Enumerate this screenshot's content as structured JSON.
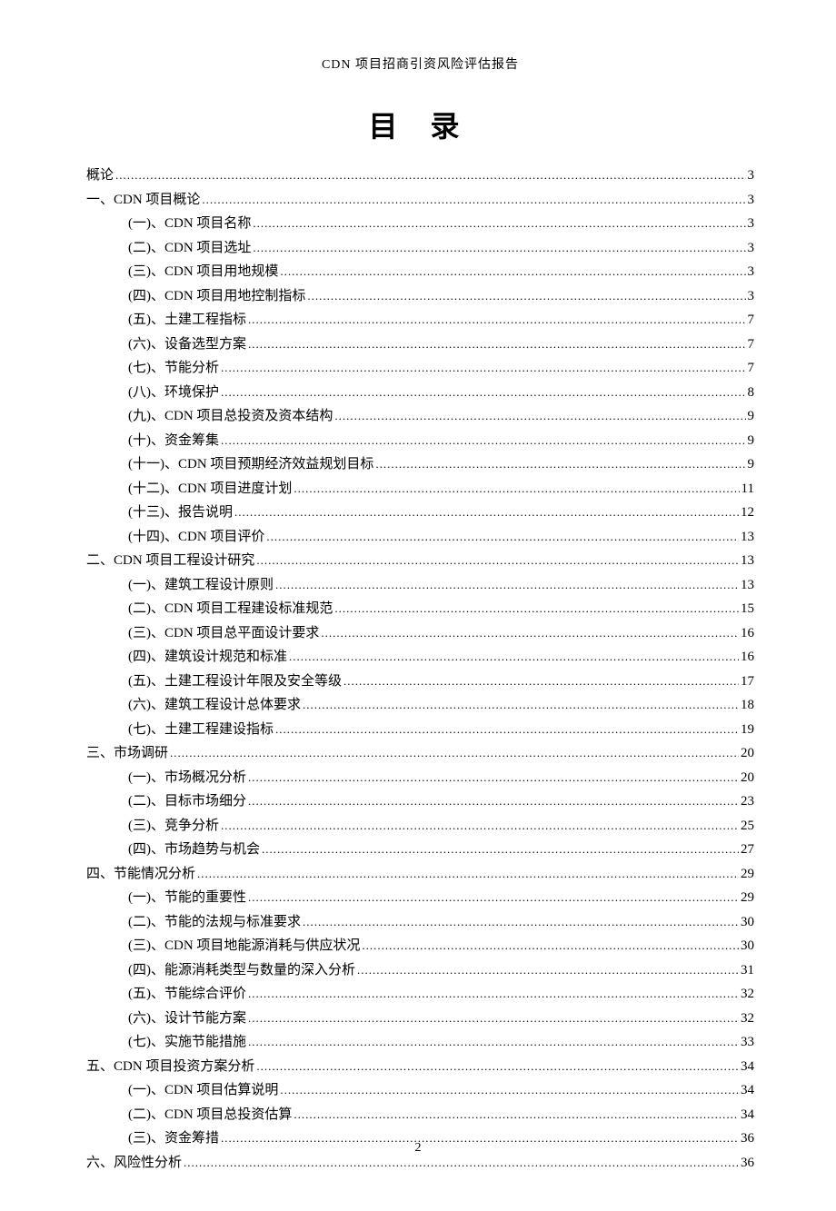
{
  "header": "CDN 项目招商引资风险评估报告",
  "title": "目 录",
  "page_number": "2",
  "toc": [
    {
      "level": 0,
      "label": "概论",
      "page": "3"
    },
    {
      "level": 1,
      "label": "一、CDN 项目概论",
      "page": "3"
    },
    {
      "level": 2,
      "label": "(一)、CDN 项目名称",
      "page": "3"
    },
    {
      "level": 2,
      "label": "(二)、CDN 项目选址",
      "page": "3"
    },
    {
      "level": 2,
      "label": "(三)、CDN 项目用地规模",
      "page": "3"
    },
    {
      "level": 2,
      "label": "(四)、CDN 项目用地控制指标",
      "page": "3"
    },
    {
      "level": 2,
      "label": "(五)、土建工程指标",
      "page": "7"
    },
    {
      "level": 2,
      "label": "(六)、设备选型方案",
      "page": "7"
    },
    {
      "level": 2,
      "label": "(七)、节能分析",
      "page": "7"
    },
    {
      "level": 2,
      "label": "(八)、环境保护",
      "page": "8"
    },
    {
      "level": 2,
      "label": "(九)、CDN 项目总投资及资本结构",
      "page": "9"
    },
    {
      "level": 2,
      "label": "(十)、资金筹集",
      "page": "9"
    },
    {
      "level": 2,
      "label": "(十一)、CDN 项目预期经济效益规划目标",
      "page": "9"
    },
    {
      "level": 2,
      "label": "(十二)、CDN 项目进度计划",
      "page": "11"
    },
    {
      "level": 2,
      "label": "(十三)、报告说明",
      "page": "12"
    },
    {
      "level": 2,
      "label": "(十四)、CDN 项目评价",
      "page": "13"
    },
    {
      "level": 1,
      "label": "二、CDN 项目工程设计研究",
      "page": "13"
    },
    {
      "level": 2,
      "label": "(一)、建筑工程设计原则",
      "page": "13"
    },
    {
      "level": 2,
      "label": "(二)、CDN 项目工程建设标准规范",
      "page": "15"
    },
    {
      "level": 2,
      "label": "(三)、CDN 项目总平面设计要求",
      "page": "16"
    },
    {
      "level": 2,
      "label": "(四)、建筑设计规范和标准",
      "page": "16"
    },
    {
      "level": 2,
      "label": "(五)、土建工程设计年限及安全等级",
      "page": "17"
    },
    {
      "level": 2,
      "label": "(六)、建筑工程设计总体要求",
      "page": "18"
    },
    {
      "level": 2,
      "label": "(七)、土建工程建设指标",
      "page": "19"
    },
    {
      "level": 1,
      "label": "三、市场调研",
      "page": "20"
    },
    {
      "level": 2,
      "label": "(一)、市场概况分析",
      "page": "20"
    },
    {
      "level": 2,
      "label": "(二)、目标市场细分",
      "page": "23"
    },
    {
      "level": 2,
      "label": "(三)、竞争分析",
      "page": "25"
    },
    {
      "level": 2,
      "label": "(四)、市场趋势与机会",
      "page": "27"
    },
    {
      "level": 1,
      "label": "四、节能情况分析",
      "page": "29"
    },
    {
      "level": 2,
      "label": "(一)、节能的重要性",
      "page": "29"
    },
    {
      "level": 2,
      "label": "(二)、节能的法规与标准要求",
      "page": "30"
    },
    {
      "level": 2,
      "label": "(三)、CDN 项目地能源消耗与供应状况",
      "page": "30"
    },
    {
      "level": 2,
      "label": "(四)、能源消耗类型与数量的深入分析",
      "page": "31"
    },
    {
      "level": 2,
      "label": "(五)、节能综合评价",
      "page": "32"
    },
    {
      "level": 2,
      "label": "(六)、设计节能方案",
      "page": "32"
    },
    {
      "level": 2,
      "label": "(七)、实施节能措施",
      "page": "33"
    },
    {
      "level": 1,
      "label": "五、CDN 项目投资方案分析",
      "page": "34"
    },
    {
      "level": 2,
      "label": "(一)、CDN 项目估算说明",
      "page": "34"
    },
    {
      "level": 2,
      "label": "(二)、CDN 项目总投资估算",
      "page": "34"
    },
    {
      "level": 2,
      "label": "(三)、资金筹措",
      "page": "36"
    },
    {
      "level": 1,
      "label": "六、风险性分析",
      "page": "36"
    }
  ]
}
